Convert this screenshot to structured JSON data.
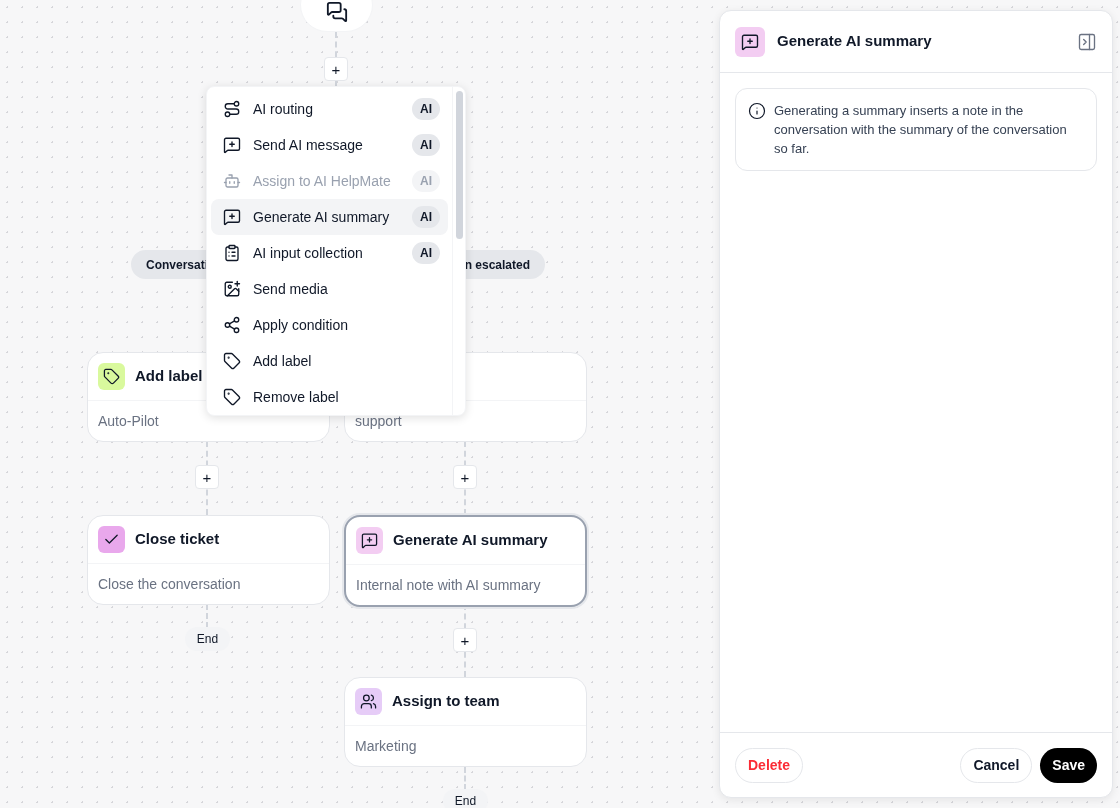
{
  "canvas": {
    "branches": [
      {
        "label": "Conversati"
      },
      {
        "label": "n escalated"
      }
    ],
    "nodes": [
      {
        "title": "Add label",
        "subtitle": "Auto-Pilot",
        "color": "#d9f99d",
        "selected": false
      },
      {
        "subtitle": "support",
        "selected": false
      },
      {
        "title": "Close ticket",
        "subtitle": "Close the conversation",
        "color": "#e9a8ec",
        "selected": false
      },
      {
        "title": "Generate AI summary",
        "subtitle": "Internal note with AI summary",
        "color": "#f3cdf2",
        "selected": true
      },
      {
        "title": "Assign to team",
        "subtitle": "Marketing",
        "color": "#e6ccf7",
        "selected": false
      }
    ],
    "plus_buttons": [
      "+",
      "+",
      "+",
      "+"
    ],
    "ends": [
      "End",
      "End"
    ]
  },
  "menu": {
    "items": [
      {
        "label": "AI routing",
        "badge": "AI",
        "disabled": false,
        "selected": false
      },
      {
        "label": "Send AI message",
        "badge": "AI",
        "disabled": false,
        "selected": false
      },
      {
        "label": "Assign to AI HelpMate",
        "badge": "AI",
        "disabled": true,
        "selected": false
      },
      {
        "label": "Generate AI summary",
        "badge": "AI",
        "disabled": false,
        "selected": true
      },
      {
        "label": "AI input collection",
        "badge": "AI",
        "disabled": false,
        "selected": false
      },
      {
        "label": "Send media",
        "disabled": false,
        "selected": false
      },
      {
        "label": "Apply condition",
        "disabled": false,
        "selected": false
      },
      {
        "label": "Add label",
        "disabled": false,
        "selected": false
      },
      {
        "label": "Remove label",
        "disabled": false,
        "selected": false
      }
    ]
  },
  "panel": {
    "title": "Generate AI summary",
    "color": "#f3cdf2",
    "info": "Generating a summary inserts a note in the conversation with the summary of the conversation so far.",
    "buttons": [
      {
        "label": "Delete",
        "kind": "danger"
      },
      {
        "label": "Cancel",
        "kind": "secondary"
      },
      {
        "label": "Save",
        "kind": "primary"
      }
    ]
  }
}
